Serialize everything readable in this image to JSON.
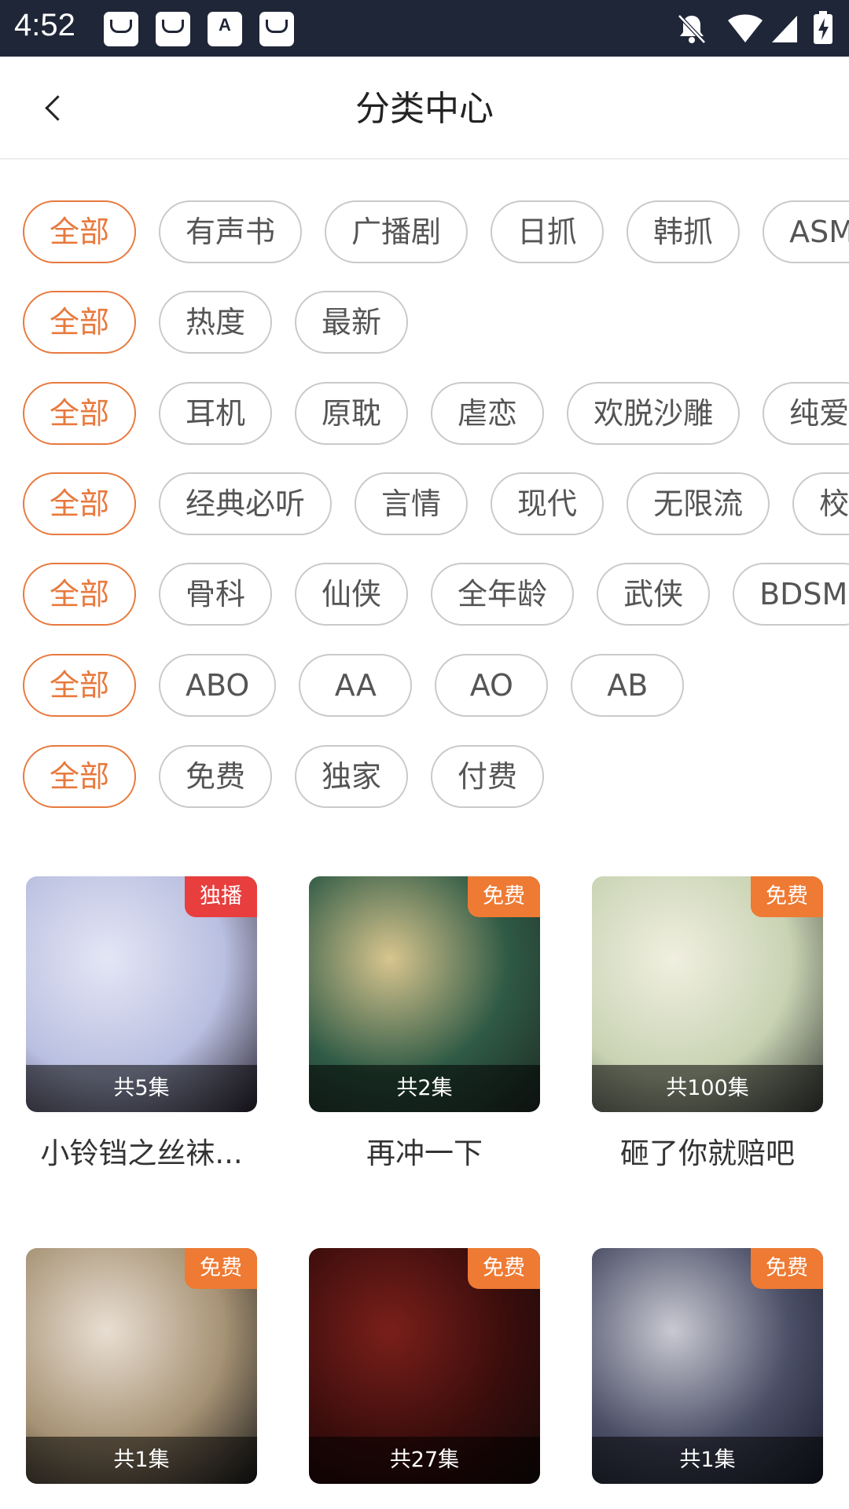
{
  "status_bar": {
    "time": "4:52"
  },
  "header": {
    "title": "分类中心"
  },
  "filter_rows": [
    [
      "全部",
      "有声书",
      "广播剧",
      "日抓",
      "韩抓",
      "ASMR"
    ],
    [
      "全部",
      "热度",
      "最新"
    ],
    [
      "全部",
      "耳机",
      "原耽",
      "虐恋",
      "欢脱沙雕",
      "纯爱"
    ],
    [
      "全部",
      "经典必听",
      "言情",
      "现代",
      "无限流",
      "校园"
    ],
    [
      "全部",
      "骨科",
      "仙侠",
      "全年龄",
      "武侠",
      "BDSM"
    ],
    [
      "全部",
      "ABO",
      "AA",
      "AO",
      "AB"
    ],
    [
      "全部",
      "免费",
      "独家",
      "付费"
    ]
  ],
  "colors": {
    "accent": "#e8793d",
    "badge_exclusive": "#e83e3e",
    "badge_free": "#ee7a33",
    "status_bar": "#1f2637"
  },
  "books": [
    {
      "title": "小铃铛之丝袜...",
      "badge": "独播",
      "badge_type": "exclusive",
      "episodes": "共5集",
      "art": [
        "#e4e6f5",
        "#b9bfe0",
        "#2a2430"
      ]
    },
    {
      "title": "再冲一下",
      "badge": "免费",
      "badge_type": "free",
      "episodes": "共2集",
      "art": [
        "#d8c58e",
        "#2f5a45",
        "#1e2a24"
      ]
    },
    {
      "title": "砸了你就赔吧",
      "badge": "免费",
      "badge_type": "free",
      "episodes": "共100集",
      "art": [
        "#f0efe0",
        "#c9d3b3",
        "#3a3f3a"
      ]
    },
    {
      "title": "",
      "badge": "免费",
      "badge_type": "free",
      "episodes": "共1集",
      "art": [
        "#e8ded2",
        "#a69274",
        "#1a1a1a"
      ]
    },
    {
      "title": "",
      "badge": "免费",
      "badge_type": "free",
      "episodes": "共27集",
      "art": [
        "#7a1f1a",
        "#3a0d0c",
        "#15090a"
      ]
    },
    {
      "title": "",
      "badge": "免费",
      "badge_type": "free",
      "episodes": "共1集",
      "art": [
        "#c9c9d2",
        "#4a4e66",
        "#1b1e2c"
      ]
    }
  ]
}
